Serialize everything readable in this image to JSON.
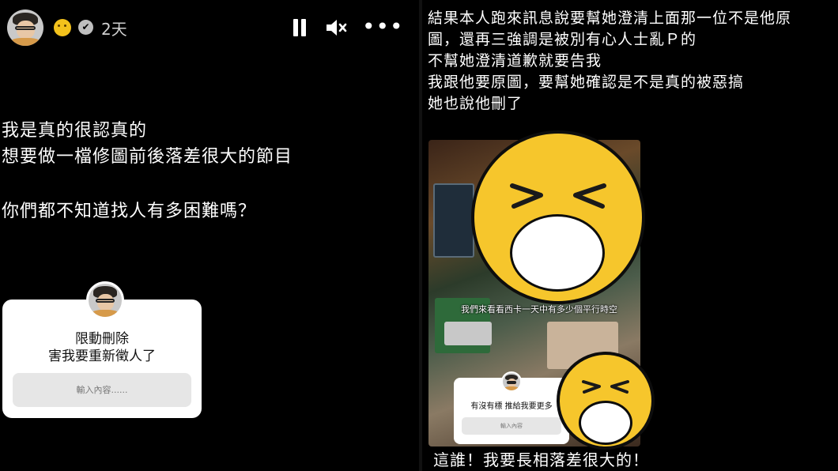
{
  "story": {
    "time_ago": "2天",
    "verified_glyph": "✔",
    "more_glyph": "•••",
    "lines": [
      "我是真的很認真的",
      "想要做一檔修圖前後落差很大的節目",
      "你們都不知道找人有多困難嗎？"
    ],
    "question_sticker": {
      "title_line1": "限動刪除",
      "title_line2": "害我要重新徵人了",
      "input_placeholder": "輸入內容......"
    },
    "icons": [
      "avatar",
      "thinking-emoji-icon",
      "verified-icon",
      "pause-icon",
      "mute-icon",
      "more-icon"
    ]
  },
  "right_post": {
    "lines": [
      "結果本人跑來訊息說要幫她澄清上面那一位不是他原",
      "圖，還再三強調是被別有心人士亂Ｐ的",
      "不幫她澄清道歉就要告我",
      "我跟他要原圖，要幫她確認是不是真的被惡搞",
      "她也說他刪了"
    ],
    "embedded_caption": "我們來看看西卡一天中有多少個平行時空",
    "embedded_sticker_title": "有沒有標 推給我要更多",
    "embedded_input_placeholder": "輸入內容",
    "bottom_caption": "這誰！我要長相落差很大的！"
  },
  "colors": {
    "background": "#000000",
    "emoji_yellow": "#f6c62c",
    "sticker_bg": "#ffffff",
    "input_bg": "#e6e6e6"
  }
}
